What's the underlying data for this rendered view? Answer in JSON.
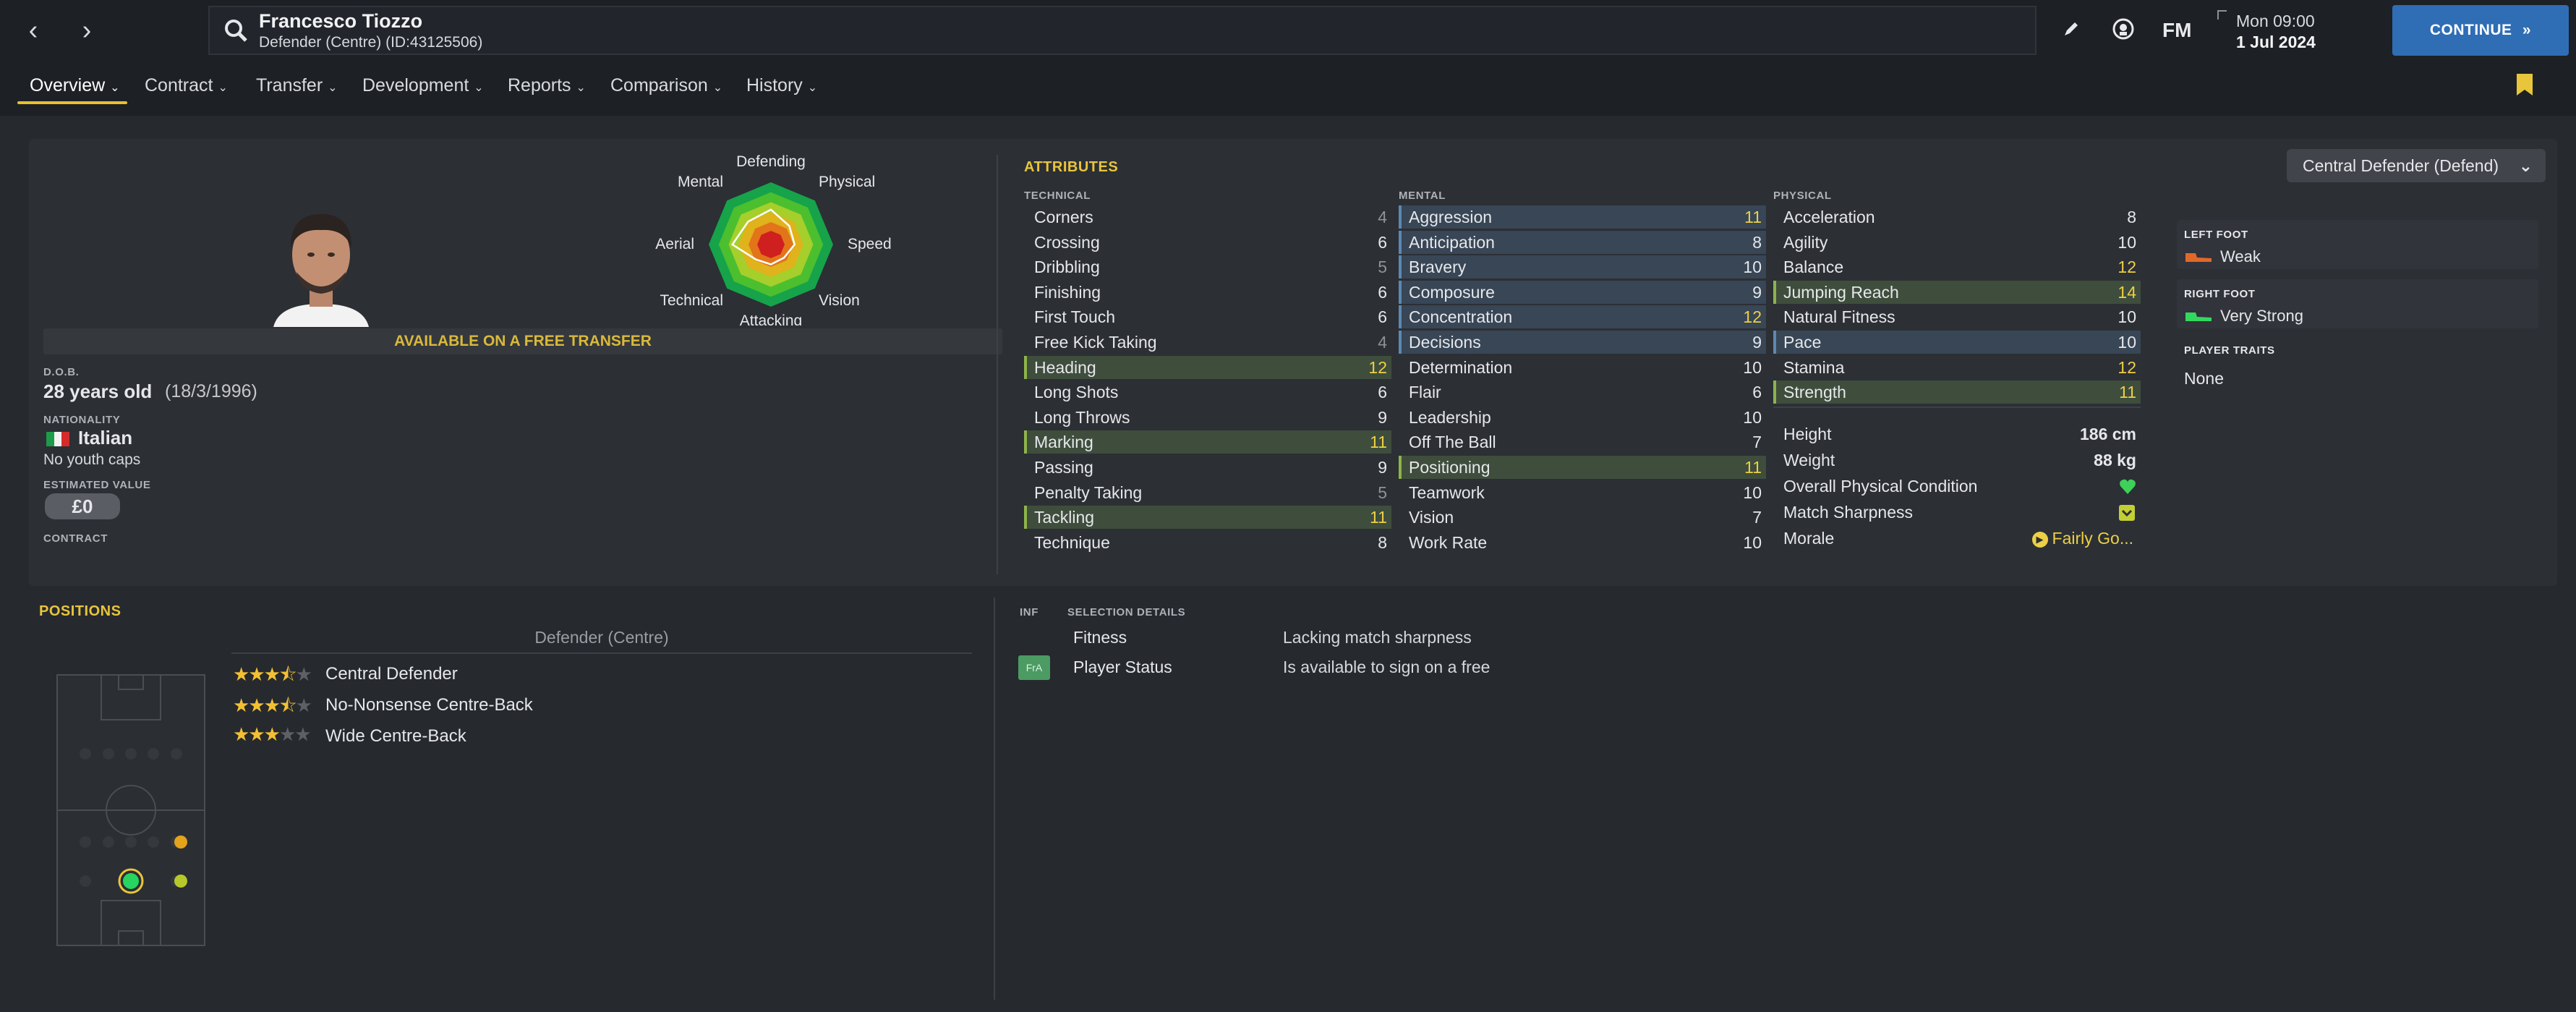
{
  "header": {
    "player_name": "Francesco Tiozzo",
    "player_sub": "Defender (Centre) (ID:43125506)",
    "fm_label": "FM",
    "date_day": "Mon 09:00",
    "date_date": "1 Jul 2024",
    "continue_label": "CONTINUE",
    "continue_icon": "double-chevron-right-icon"
  },
  "tabs": [
    "Overview",
    "Contract",
    "Transfer",
    "Development",
    "Reports",
    "Comparison",
    "History"
  ],
  "profile": {
    "transfer_status": "AVAILABLE ON A FREE TRANSFER",
    "dob_label": "D.O.B.",
    "age": "28 years old",
    "dob": "(18/3/1996)",
    "nationality_label": "NATIONALITY",
    "nationality": "Italian",
    "youth_caps": "No youth caps",
    "value_label": "ESTIMATED VALUE",
    "value": "£0",
    "contract_label": "CONTRACT"
  },
  "radar": {
    "labels": [
      "Defending",
      "Physical",
      "Speed",
      "Vision",
      "Attacking",
      "Technical",
      "Aerial",
      "Mental"
    ],
    "colors": [
      "#16a34a",
      "#4cbf2f",
      "#a6cf2b",
      "#e0b21c",
      "#e27419",
      "#cf1f1f"
    ]
  },
  "attributes": {
    "title": "ATTRIBUTES",
    "role_select": "Central Defender (Defend)",
    "technical_label": "TECHNICAL",
    "mental_label": "MENTAL",
    "physical_label": "PHYSICAL",
    "technical": [
      {
        "name": "Corners",
        "value": "4"
      },
      {
        "name": "Crossing",
        "value": "6"
      },
      {
        "name": "Dribbling",
        "value": "5"
      },
      {
        "name": "Finishing",
        "value": "6"
      },
      {
        "name": "First Touch",
        "value": "6"
      },
      {
        "name": "Free Kick Taking",
        "value": "4"
      },
      {
        "name": "Heading",
        "value": "12"
      },
      {
        "name": "Long Shots",
        "value": "6"
      },
      {
        "name": "Long Throws",
        "value": "9"
      },
      {
        "name": "Marking",
        "value": "11"
      },
      {
        "name": "Passing",
        "value": "9"
      },
      {
        "name": "Penalty Taking",
        "value": "5"
      },
      {
        "name": "Tackling",
        "value": "11"
      },
      {
        "name": "Technique",
        "value": "8"
      }
    ],
    "mental": [
      {
        "name": "Aggression",
        "value": "11"
      },
      {
        "name": "Anticipation",
        "value": "8"
      },
      {
        "name": "Bravery",
        "value": "10"
      },
      {
        "name": "Composure",
        "value": "9"
      },
      {
        "name": "Concentration",
        "value": "12"
      },
      {
        "name": "Decisions",
        "value": "9"
      },
      {
        "name": "Determination",
        "value": "10"
      },
      {
        "name": "Flair",
        "value": "6"
      },
      {
        "name": "Leadership",
        "value": "10"
      },
      {
        "name": "Off The Ball",
        "value": "7"
      },
      {
        "name": "Positioning",
        "value": "11"
      },
      {
        "name": "Teamwork",
        "value": "10"
      },
      {
        "name": "Vision",
        "value": "7"
      },
      {
        "name": "Work Rate",
        "value": "10"
      }
    ],
    "physical": [
      {
        "name": "Acceleration",
        "value": "8"
      },
      {
        "name": "Agility",
        "value": "10"
      },
      {
        "name": "Balance",
        "value": "12"
      },
      {
        "name": "Jumping Reach",
        "value": "14"
      },
      {
        "name": "Natural Fitness",
        "value": "10"
      },
      {
        "name": "Pace",
        "value": "10"
      },
      {
        "name": "Stamina",
        "value": "12"
      },
      {
        "name": "Strength",
        "value": "11"
      }
    ],
    "extra": {
      "height_label": "Height",
      "height": "186 cm",
      "weight_label": "Weight",
      "weight": "88 kg",
      "condition_label": "Overall Physical Condition",
      "sharpness_label": "Match Sharpness",
      "morale_label": "Morale",
      "morale": "Fairly Go..."
    }
  },
  "feet": {
    "left_label": "LEFT FOOT",
    "left": "Weak",
    "right_label": "RIGHT FOOT",
    "right": "Very Strong",
    "traits_label": "PLAYER TRAITS",
    "traits": "None"
  },
  "positions": {
    "title": "POSITIONS",
    "main": "Defender (Centre)",
    "roles": [
      {
        "name": "Central Defender",
        "stars": 3.5
      },
      {
        "name": "No-Nonsense Centre-Back",
        "stars": 3.5
      },
      {
        "name": "Wide Centre-Back",
        "stars": 3
      }
    ]
  },
  "selection": {
    "inf_label": "INF",
    "title": "SELECTION DETAILS",
    "rows": [
      {
        "badge": "",
        "label": "Fitness",
        "value": "Lacking match sharpness"
      },
      {
        "badge": "FrA",
        "label": "Player Status",
        "value": "Is available to sign on a free"
      }
    ]
  },
  "colors": {
    "accent": "#e8c53b",
    "continue": "#2f6db5",
    "green_highlight": "#3f4d3d",
    "blue_highlight": "#384656"
  }
}
